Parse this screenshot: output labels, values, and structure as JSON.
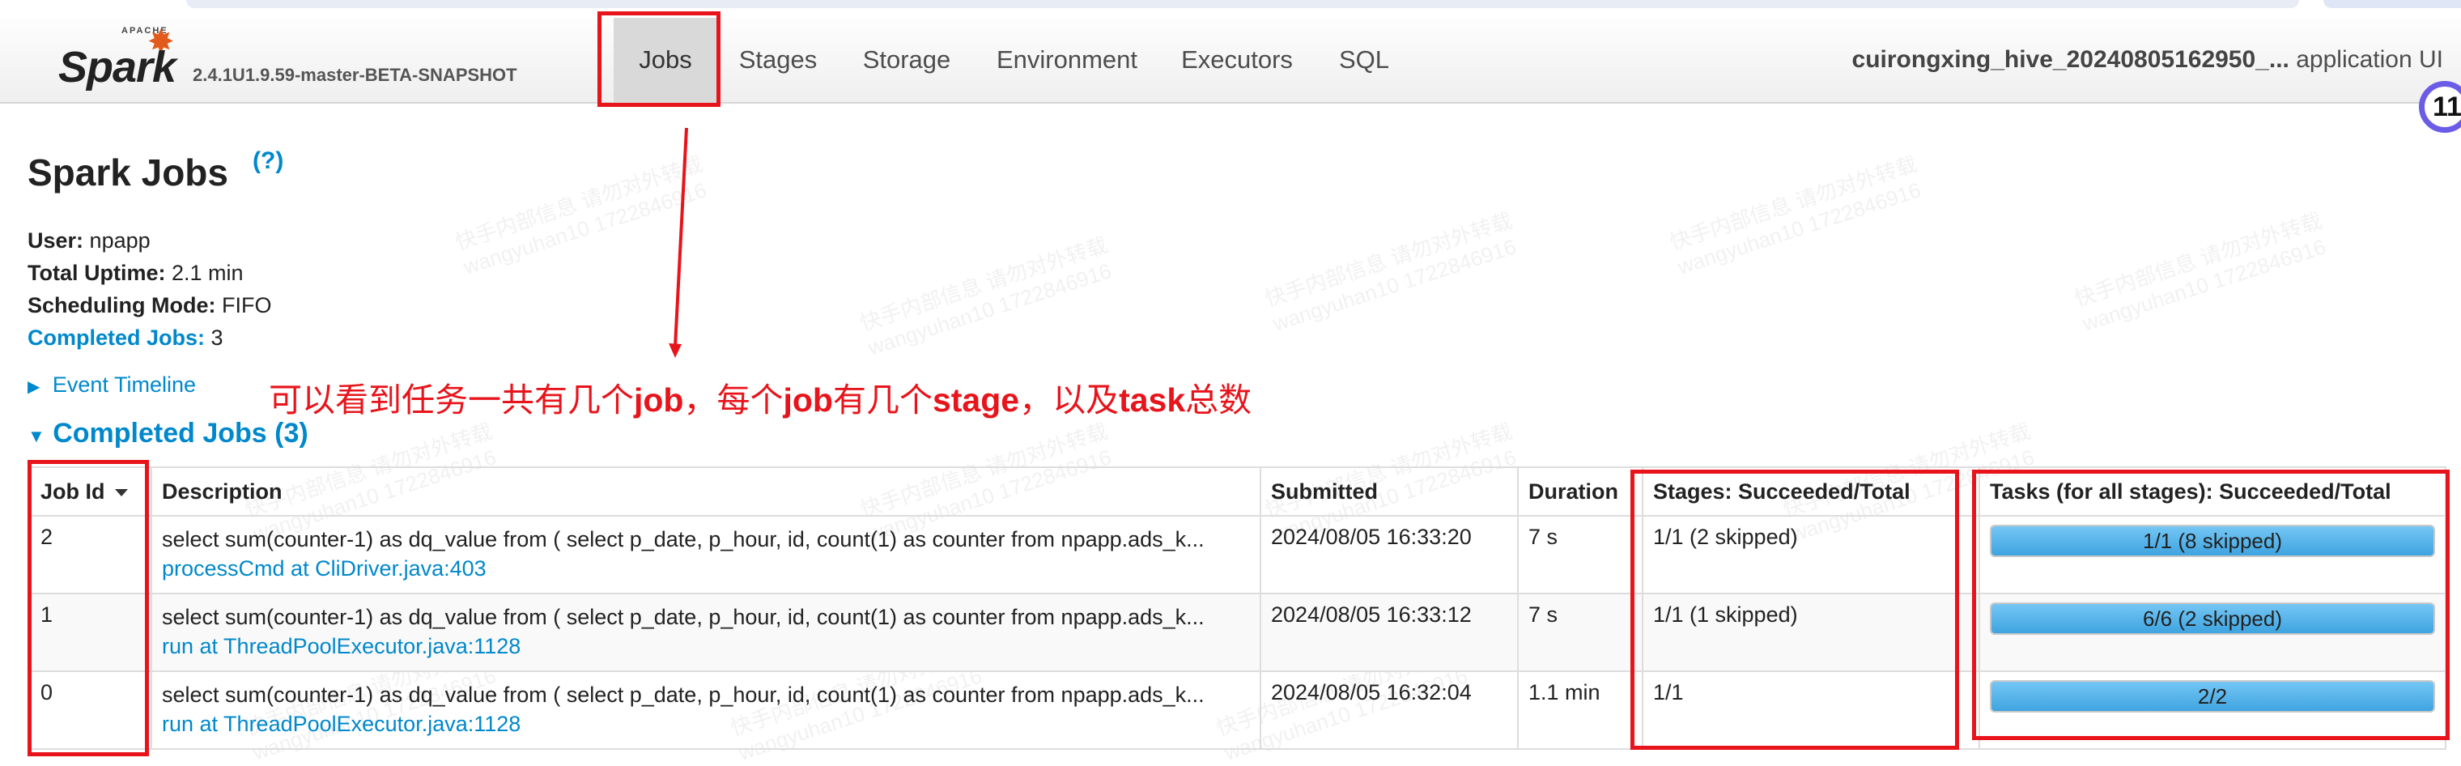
{
  "navbar": {
    "logo_text": "Spark",
    "logo_apache": "APACHE",
    "version": "2.4.1U1.9.59-master-BETA-SNAPSHOT",
    "tabs": [
      {
        "label": "Jobs",
        "active": true
      },
      {
        "label": "Stages",
        "active": false
      },
      {
        "label": "Storage",
        "active": false
      },
      {
        "label": "Environment",
        "active": false
      },
      {
        "label": "Executors",
        "active": false
      },
      {
        "label": "SQL",
        "active": false
      }
    ],
    "app_name": "cuirongxing_hive_20240805162950_...",
    "app_suffix": "application UI"
  },
  "page": {
    "title": "Spark Jobs",
    "help": "(?)",
    "user_label": "User:",
    "user": "npapp",
    "uptime_label": "Total Uptime:",
    "uptime": "2.1 min",
    "scheduling_label": "Scheduling Mode:",
    "scheduling": "FIFO",
    "completed_label": "Completed Jobs:",
    "completed": "3",
    "event_timeline": "Event Timeline",
    "section_title": "Completed Jobs (3)"
  },
  "annotation": {
    "part1": "可以看到任务一共有几个",
    "job1": "job",
    "part2": "，每个",
    "job2": "job",
    "part3": "有几个",
    "stage": "stage",
    "part4": "，以及",
    "task": "task",
    "part5": "总数",
    "color": "#e8141b"
  },
  "table": {
    "headers": {
      "job_id": "Job Id",
      "description": "Description",
      "submitted": "Submitted",
      "duration": "Duration",
      "stages": "Stages: Succeeded/Total",
      "tasks": "Tasks (for all stages): Succeeded/Total"
    },
    "rows": [
      {
        "job_id": "2",
        "desc": "select sum(counter-1) as dq_value from ( select p_date, p_hour, id, count(1) as counter from npapp.ads_k...",
        "desc_link": "processCmd at CliDriver.java:403",
        "submitted": "2024/08/05 16:33:20",
        "duration": "7 s",
        "stages": "1/1 (2 skipped)",
        "tasks": "1/1 (8 skipped)",
        "tasks_progress": 1.0
      },
      {
        "job_id": "1",
        "desc": "select sum(counter-1) as dq_value from ( select p_date, p_hour, id, count(1) as counter from npapp.ads_k...",
        "desc_link": "run at ThreadPoolExecutor.java:1128",
        "submitted": "2024/08/05 16:33:12",
        "duration": "7 s",
        "stages": "1/1 (1 skipped)",
        "tasks": "6/6 (2 skipped)",
        "tasks_progress": 1.0
      },
      {
        "job_id": "0",
        "desc": "select sum(counter-1) as dq_value from ( select p_date, p_hour, id, count(1) as counter from npapp.ads_k...",
        "desc_link": "run at ThreadPoolExecutor.java:1128",
        "submitted": "2024/08/05 16:32:04",
        "duration": "1.1 min",
        "stages": "1/1",
        "tasks": "2/2",
        "tasks_progress": 1.0
      }
    ]
  },
  "badge": {
    "text": "11"
  },
  "watermark": {
    "line1": "快手内部信息 请勿对外转载",
    "line2": "wangyuhan10 1722846916"
  }
}
